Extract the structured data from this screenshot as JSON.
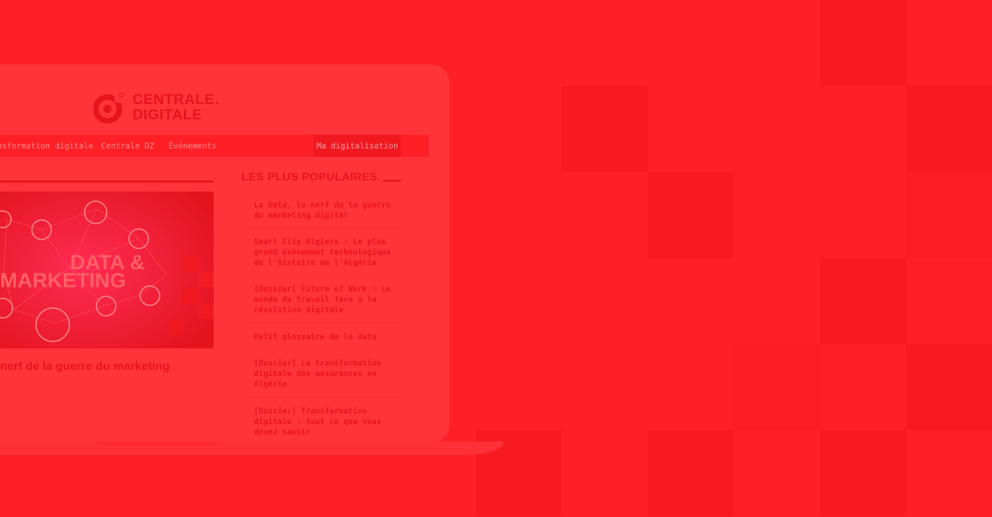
{
  "logo": {
    "line1": "CENTRALE.",
    "line2": "DIGITALE",
    "registered": "®"
  },
  "nav": {
    "items": [
      "nsformation digitale",
      "Centrale DZ",
      "Événements"
    ],
    "cta": "Ma digitalisation"
  },
  "hero": {
    "image_text_line1": "DATA &",
    "image_text_line2": "MARKETING",
    "title": "nerf de la guerre du marketing"
  },
  "popular": {
    "heading": "LES PLUS POPULAIRES.",
    "items": [
      "La Data, le nerf de la guerre du marketing digital",
      "Smart City Algiers : Le plus grand évènement technologique de l'histoire de l'Algérie",
      "[Dossier] Future of Work : Le monde du travail face à la révolution digitale",
      "Petit glossaire de la data",
      "[Dossier] La transformation digitale des assurances en Algérie",
      "[Dossier] Transformation digitale : tout ce que vous devez savoir"
    ]
  },
  "colors": {
    "background": "#ff1f27",
    "accent": "#e8141c",
    "laptop": "#ff343b"
  }
}
